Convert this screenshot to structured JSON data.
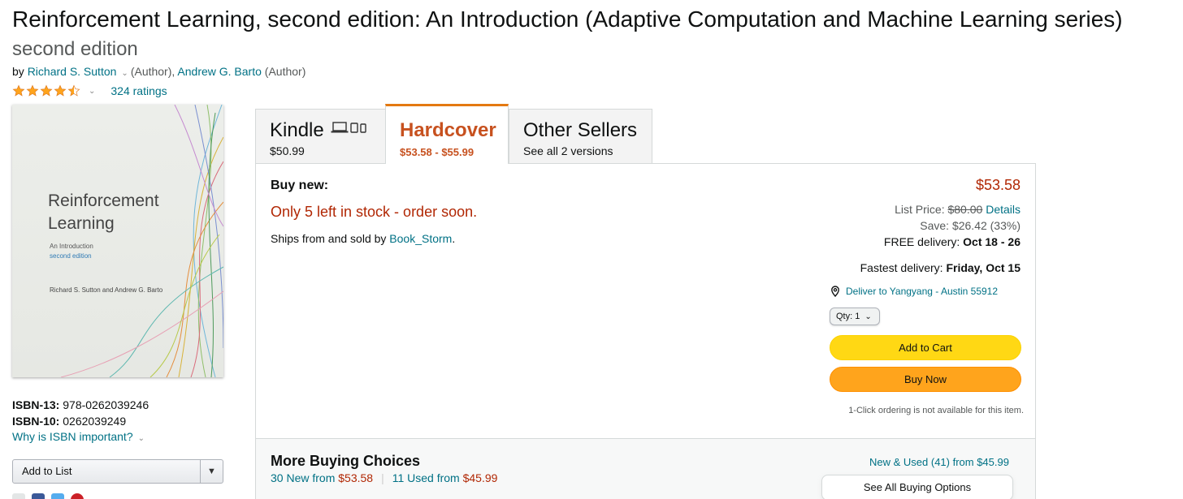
{
  "product": {
    "title": "Reinforcement Learning, second edition: An Introduction (Adaptive Computation and Machine Learning series)",
    "subtitle": "second edition",
    "by": "by",
    "author1": "Richard S. Sutton",
    "author1_role": "(Author),",
    "author2": "Andrew G. Barto",
    "author2_role": "(Author)",
    "ratings": "324 ratings",
    "stars": 4.5
  },
  "cover": {
    "title_line1": "Reinforcement",
    "title_line2": "Learning",
    "line_intro": "An Introduction",
    "line_edition": "second edition",
    "line_authors": "Richard S. Sutton and Andrew G. Barto"
  },
  "isbn": {
    "isbn13_label": "ISBN-13:",
    "isbn13_value": "978-0262039246",
    "isbn10_label": "ISBN-10:",
    "isbn10_value": "0262039249",
    "why": "Why is ISBN important?"
  },
  "add_to_list": "Add to List",
  "tabs": [
    {
      "name": "Kindle",
      "price": "$50.99"
    },
    {
      "name": "Hardcover",
      "price": "$53.58 - $55.99"
    },
    {
      "name": "Other Sellers",
      "price": "See all 2 versions"
    }
  ],
  "offer": {
    "buy_new": "Buy new:",
    "price": "$53.58",
    "stock": "Only 5 left in stock - order soon.",
    "ships_prefix": "Ships from and sold by",
    "seller": "Book_Storm",
    "ships_suffix": ".",
    "list_price_label": "List Price:",
    "list_price": "$80.00",
    "details": "Details",
    "save": "Save: $26.42 (33%)",
    "free_delivery_label": "FREE delivery:",
    "free_delivery_date": "Oct 18 - 26",
    "fastest_label": "Fastest delivery:",
    "fastest_date": "Friday, Oct 15",
    "deliver_to": "Deliver to Yangyang - Austin 55912",
    "qty_label": "Qty:",
    "qty_value": "1",
    "add_to_cart": "Add to Cart",
    "buy_now": "Buy Now",
    "one_click": "1-Click ordering is not available for this item."
  },
  "more_buying": {
    "heading": "More Buying Choices",
    "new_count": "30 New from",
    "new_price": "$53.58",
    "used_count": "11 Used from",
    "used_price": "$45.99",
    "new_used": "New & Used (41) from $45.99",
    "see_all": "See All Buying Options"
  },
  "colors": {
    "link": "#007185",
    "price": "#b12704",
    "tab_active": "#c7511f",
    "star": "#ffa41c",
    "cart": "#ffd814",
    "buy_now": "#ffa41c"
  }
}
